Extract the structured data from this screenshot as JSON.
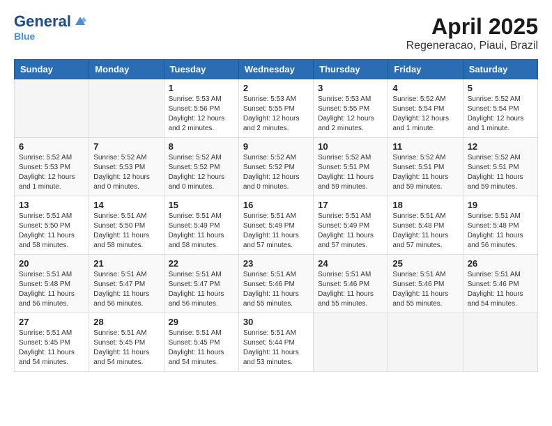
{
  "header": {
    "logo_general": "General",
    "logo_blue": "Blue",
    "month_year": "April 2025",
    "location": "Regeneracao, Piaui, Brazil"
  },
  "weekdays": [
    "Sunday",
    "Monday",
    "Tuesday",
    "Wednesday",
    "Thursday",
    "Friday",
    "Saturday"
  ],
  "weeks": [
    [
      {
        "day": "",
        "info": ""
      },
      {
        "day": "",
        "info": ""
      },
      {
        "day": "1",
        "info": "Sunrise: 5:53 AM\nSunset: 5:56 PM\nDaylight: 12 hours\nand 2 minutes."
      },
      {
        "day": "2",
        "info": "Sunrise: 5:53 AM\nSunset: 5:55 PM\nDaylight: 12 hours\nand 2 minutes."
      },
      {
        "day": "3",
        "info": "Sunrise: 5:53 AM\nSunset: 5:55 PM\nDaylight: 12 hours\nand 2 minutes."
      },
      {
        "day": "4",
        "info": "Sunrise: 5:52 AM\nSunset: 5:54 PM\nDaylight: 12 hours\nand 1 minute."
      },
      {
        "day": "5",
        "info": "Sunrise: 5:52 AM\nSunset: 5:54 PM\nDaylight: 12 hours\nand 1 minute."
      }
    ],
    [
      {
        "day": "6",
        "info": "Sunrise: 5:52 AM\nSunset: 5:53 PM\nDaylight: 12 hours\nand 1 minute."
      },
      {
        "day": "7",
        "info": "Sunrise: 5:52 AM\nSunset: 5:53 PM\nDaylight: 12 hours\nand 0 minutes."
      },
      {
        "day": "8",
        "info": "Sunrise: 5:52 AM\nSunset: 5:52 PM\nDaylight: 12 hours\nand 0 minutes."
      },
      {
        "day": "9",
        "info": "Sunrise: 5:52 AM\nSunset: 5:52 PM\nDaylight: 12 hours\nand 0 minutes."
      },
      {
        "day": "10",
        "info": "Sunrise: 5:52 AM\nSunset: 5:51 PM\nDaylight: 11 hours\nand 59 minutes."
      },
      {
        "day": "11",
        "info": "Sunrise: 5:52 AM\nSunset: 5:51 PM\nDaylight: 11 hours\nand 59 minutes."
      },
      {
        "day": "12",
        "info": "Sunrise: 5:52 AM\nSunset: 5:51 PM\nDaylight: 11 hours\nand 59 minutes."
      }
    ],
    [
      {
        "day": "13",
        "info": "Sunrise: 5:51 AM\nSunset: 5:50 PM\nDaylight: 11 hours\nand 58 minutes."
      },
      {
        "day": "14",
        "info": "Sunrise: 5:51 AM\nSunset: 5:50 PM\nDaylight: 11 hours\nand 58 minutes."
      },
      {
        "day": "15",
        "info": "Sunrise: 5:51 AM\nSunset: 5:49 PM\nDaylight: 11 hours\nand 58 minutes."
      },
      {
        "day": "16",
        "info": "Sunrise: 5:51 AM\nSunset: 5:49 PM\nDaylight: 11 hours\nand 57 minutes."
      },
      {
        "day": "17",
        "info": "Sunrise: 5:51 AM\nSunset: 5:49 PM\nDaylight: 11 hours\nand 57 minutes."
      },
      {
        "day": "18",
        "info": "Sunrise: 5:51 AM\nSunset: 5:48 PM\nDaylight: 11 hours\nand 57 minutes."
      },
      {
        "day": "19",
        "info": "Sunrise: 5:51 AM\nSunset: 5:48 PM\nDaylight: 11 hours\nand 56 minutes."
      }
    ],
    [
      {
        "day": "20",
        "info": "Sunrise: 5:51 AM\nSunset: 5:48 PM\nDaylight: 11 hours\nand 56 minutes."
      },
      {
        "day": "21",
        "info": "Sunrise: 5:51 AM\nSunset: 5:47 PM\nDaylight: 11 hours\nand 56 minutes."
      },
      {
        "day": "22",
        "info": "Sunrise: 5:51 AM\nSunset: 5:47 PM\nDaylight: 11 hours\nand 56 minutes."
      },
      {
        "day": "23",
        "info": "Sunrise: 5:51 AM\nSunset: 5:46 PM\nDaylight: 11 hours\nand 55 minutes."
      },
      {
        "day": "24",
        "info": "Sunrise: 5:51 AM\nSunset: 5:46 PM\nDaylight: 11 hours\nand 55 minutes."
      },
      {
        "day": "25",
        "info": "Sunrise: 5:51 AM\nSunset: 5:46 PM\nDaylight: 11 hours\nand 55 minutes."
      },
      {
        "day": "26",
        "info": "Sunrise: 5:51 AM\nSunset: 5:46 PM\nDaylight: 11 hours\nand 54 minutes."
      }
    ],
    [
      {
        "day": "27",
        "info": "Sunrise: 5:51 AM\nSunset: 5:45 PM\nDaylight: 11 hours\nand 54 minutes."
      },
      {
        "day": "28",
        "info": "Sunrise: 5:51 AM\nSunset: 5:45 PM\nDaylight: 11 hours\nand 54 minutes."
      },
      {
        "day": "29",
        "info": "Sunrise: 5:51 AM\nSunset: 5:45 PM\nDaylight: 11 hours\nand 54 minutes."
      },
      {
        "day": "30",
        "info": "Sunrise: 5:51 AM\nSunset: 5:44 PM\nDaylight: 11 hours\nand 53 minutes."
      },
      {
        "day": "",
        "info": ""
      },
      {
        "day": "",
        "info": ""
      },
      {
        "day": "",
        "info": ""
      }
    ]
  ]
}
